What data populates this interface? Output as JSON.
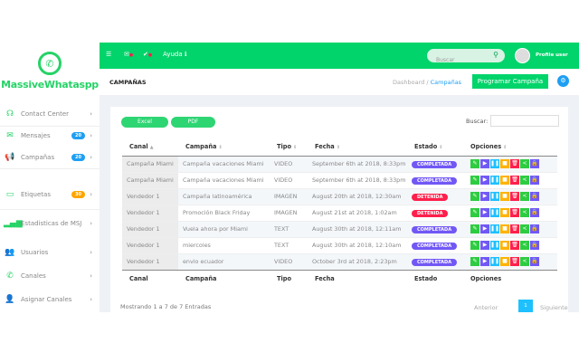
{
  "brand": {
    "name": "MassiveWhataspp",
    "color": "#25d366"
  },
  "sidebar": {
    "items": [
      {
        "label": "Contact Center",
        "icon": "headset-icon"
      },
      {
        "label": "Mensajes",
        "icon": "envelope-icon",
        "badge": "20",
        "badge_color": "#1e9ff2"
      },
      {
        "label": "Campañas",
        "icon": "megaphone-icon",
        "badge": "20",
        "badge_color": "#1e9ff2"
      },
      {
        "label": "Etiquetas",
        "icon": "tag-icon",
        "badge": "30",
        "badge_color": "#ffa502"
      },
      {
        "label": "Estadisticas de MSJ",
        "icon": "signal-icon"
      },
      {
        "label": "Usuarios",
        "icon": "users-icon"
      },
      {
        "label": "Canales",
        "icon": "phone-icon"
      },
      {
        "label": "Asignar Canales",
        "icon": "user-assign-icon"
      }
    ]
  },
  "topbar": {
    "help": "Ayuda",
    "search_placeholder": "Buscar",
    "profile": "Profile user"
  },
  "page": {
    "title": "CAMPAÑAS",
    "breadcrumb": [
      "Dashboard",
      "Campañas"
    ],
    "primary_button": "Programar Campaña"
  },
  "table": {
    "export_buttons": [
      "Excel",
      "PDF"
    ],
    "search_label": "Buscar:",
    "columns": [
      "Canal",
      "Campaña",
      "Tipo",
      "Fecha",
      "Estado",
      "Opciones"
    ],
    "rows": [
      [
        "Campaña Miami",
        "Campaña vacaciones Miami",
        "VIDEO",
        "September 6th at 2018, 8:33pm",
        "COMPLETADA"
      ],
      [
        "Campaña Miami",
        "Campaña vacaciones Miami",
        "VIDEO",
        "September 6th at 2018, 8:33pm",
        "COMPLETADA"
      ],
      [
        "Vendedor 1",
        "Campaña latinoamérica",
        "IMAGEN",
        "August 20th at 2018, 12:30am",
        "DETENIDA"
      ],
      [
        "Vendedor 1",
        "Promoción Black Friday",
        "IMAGEN",
        "August 21st at 2018, 1:02am",
        "DETENIDA"
      ],
      [
        "Vendedor 1",
        "Vuela ahora por Miami",
        "TEXT",
        "August 30th at 2018, 12:11am",
        "COMPLETADA"
      ],
      [
        "Vendedor 1",
        "miercoles",
        "TEXT",
        "August 30th at 2018, 12:10am",
        "COMPLETADA"
      ],
      [
        "Vendedor 1",
        "envio ecuador",
        "VIDEO",
        "October 3rd at 2018, 2:23pm",
        "COMPLETADA"
      ]
    ],
    "status_colors": {
      "COMPLETADA": "#7158f5",
      "DETENIDA": "#ff1f4b"
    },
    "options": [
      {
        "icon": "edit-icon",
        "color": "#2ecc40"
      },
      {
        "icon": "play-icon",
        "color": "#7158f5"
      },
      {
        "icon": "pause-icon",
        "color": "#1ec0ff"
      },
      {
        "icon": "stop-icon",
        "color": "#ffb300"
      },
      {
        "icon": "trash-icon",
        "color": "#ff1f4b"
      },
      {
        "icon": "share-icon",
        "color": "#2ecc40"
      },
      {
        "icon": "lock-icon",
        "color": "#7158f5"
      }
    ],
    "info": "Mostrando 1 a 7 de 7 Entradas",
    "pagination": {
      "prev": "Anterior",
      "current": "1",
      "next": "Siguiente"
    }
  }
}
